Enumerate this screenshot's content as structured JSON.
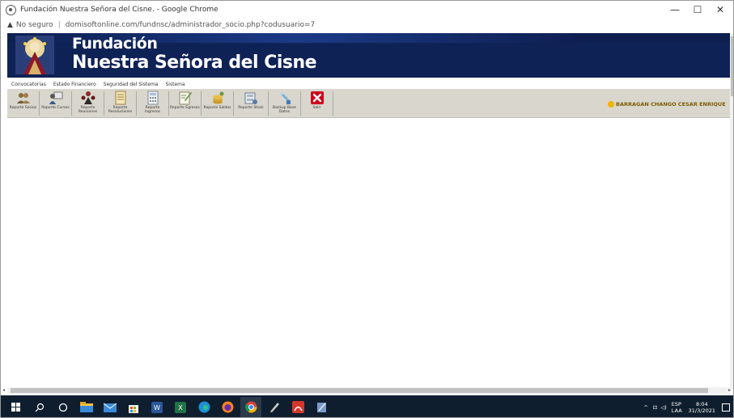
{
  "browser": {
    "title": "Fundación Nuestra Señora del Cisne. - Google Chrome",
    "security": "No seguro",
    "url": "domisoftonline.com/fundnsc/administrador_socio.php?codusuario=7"
  },
  "header": {
    "title_line1": "Fundación",
    "title_line2": "Nuestra Señora del Cisne"
  },
  "menu": [
    "Convocatorias",
    "Estado Financiero",
    "Seguridad del Sistema",
    "Sistema"
  ],
  "toolbar": [
    {
      "label": "Reporte Socios",
      "icon": "users-icon"
    },
    {
      "label": "Reporte Cursos",
      "icon": "person-board-icon"
    },
    {
      "label": "Reporte Reuniones",
      "icon": "meeting-icon"
    },
    {
      "label": "Reporte Resoluciones",
      "icon": "document-icon"
    },
    {
      "label": "Reporte Ingresos",
      "icon": "calculator-icon"
    },
    {
      "label": "Reporte Egresos",
      "icon": "edit-document-icon"
    },
    {
      "label": "Reporte Saldos",
      "icon": "coins-icon"
    },
    {
      "label": "Reporte Stock",
      "icon": "inventory-icon"
    },
    {
      "label": "Backup Base Datos",
      "icon": "backup-icon"
    },
    {
      "label": "Salir",
      "icon": "exit-icon"
    }
  ],
  "user": {
    "name": "BARRAGAN CHANGO CESAR ENRIQUE"
  },
  "tray": {
    "lang1": "ESP",
    "lang2": "LAA",
    "time": "8:04",
    "date": "31/3/2021"
  },
  "colors": {
    "banner": "#0f2256",
    "toolbar": "#d9d6cd",
    "user_text": "#7a5d00",
    "exit": "#d0021b"
  }
}
